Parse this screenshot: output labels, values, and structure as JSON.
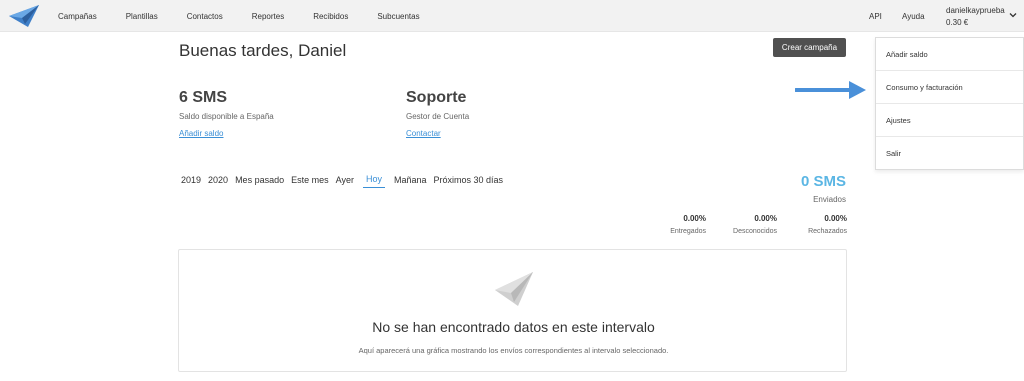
{
  "nav": {
    "items": [
      "Campañas",
      "Plantillas",
      "Contactos",
      "Reportes",
      "Recibidos",
      "Subcuentas"
    ],
    "api": "API",
    "help": "Ayuda",
    "user_name": "danielkayprueba",
    "user_balance": "0.30 €"
  },
  "main": {
    "greeting": "Buenas tardes, Daniel",
    "create_button": "Crear campaña",
    "sms_block": {
      "title": "6 SMS",
      "subtitle": "Saldo disponible a España",
      "link": "Añadir saldo"
    },
    "support_block": {
      "title": "Soporte",
      "subtitle": "Gestor de Cuenta",
      "link": "Contactar"
    },
    "filters": [
      "2019",
      "2020",
      "Mes pasado",
      "Este mes",
      "Ayer",
      "Hoy",
      "Mañana",
      "Próximos 30 días"
    ],
    "active_filter": "Hoy",
    "sent_total": "0 SMS",
    "sent_label": "Enviados",
    "stats": [
      {
        "value": "0.00%",
        "label": "Entregados"
      },
      {
        "value": "0.00%",
        "label": "Desconocidos"
      },
      {
        "value": "0.00%",
        "label": "Rechazados"
      }
    ],
    "empty": {
      "title": "No se han encontrado datos en este intervalo",
      "description": "Aquí aparecerá una gráfica mostrando los envíos correspondientes al intervalo seleccionado."
    }
  },
  "dropdown": {
    "items": [
      "Añadir saldo",
      "Consumo y facturación",
      "Ajustes",
      "Salir"
    ]
  },
  "colors": {
    "accent": "#3a8fd6",
    "sms_total": "#5bb6e4",
    "button_bg": "#505050",
    "arrow": "#4a90d9"
  }
}
